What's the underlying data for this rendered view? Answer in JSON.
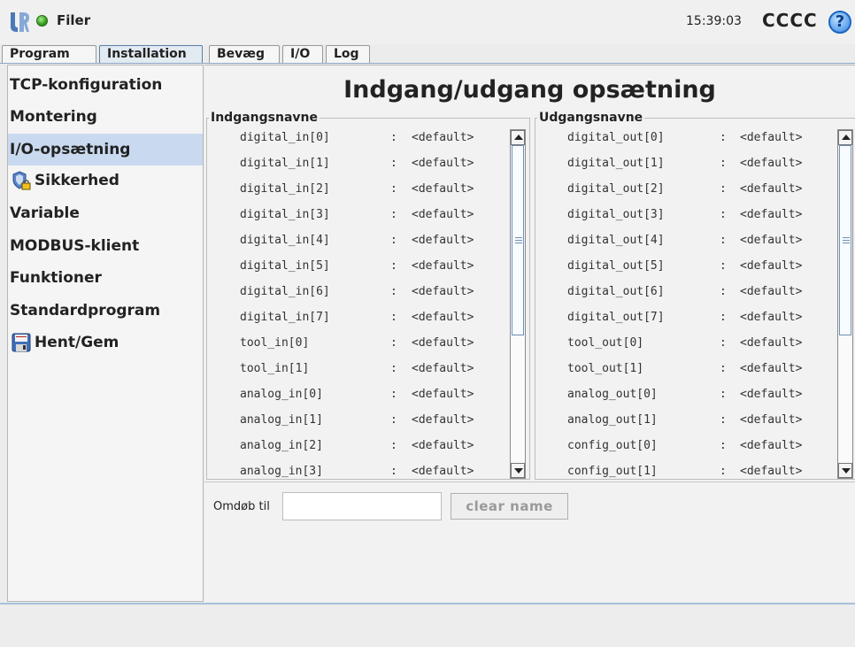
{
  "header": {
    "app_label": "Filer",
    "time": "15:39:03",
    "robot_name": "CCCC",
    "help_symbol": "?",
    "status_color": "#3aa020",
    "logo_icon": "ur-logo-icon"
  },
  "tabs": {
    "program": "Program",
    "installation": "Installation",
    "move": "Bevæg",
    "io": "I/O",
    "log": "Log"
  },
  "sidebar": {
    "items": [
      {
        "label": "TCP-konfiguration"
      },
      {
        "label": "Montering"
      },
      {
        "label": "I/O-opsætning"
      },
      {
        "label": "Sikkerhed",
        "icon": "shield-lock-icon"
      },
      {
        "label": "Variable"
      },
      {
        "label": "MODBUS-klient"
      },
      {
        "label": "Funktioner"
      },
      {
        "label": "Standardprogram"
      },
      {
        "label": "Hent/Gem",
        "icon": "floppy-disk-icon"
      }
    ],
    "active_index": 2
  },
  "main": {
    "title": "Indgang/udgang opsætning",
    "separator": ":",
    "inputs": {
      "title": "Indgangsnavne",
      "rows": [
        {
          "name": "digital_in[0]",
          "value": "<default>"
        },
        {
          "name": "digital_in[1]",
          "value": "<default>"
        },
        {
          "name": "digital_in[2]",
          "value": "<default>"
        },
        {
          "name": "digital_in[3]",
          "value": "<default>"
        },
        {
          "name": "digital_in[4]",
          "value": "<default>"
        },
        {
          "name": "digital_in[5]",
          "value": "<default>"
        },
        {
          "name": "digital_in[6]",
          "value": "<default>"
        },
        {
          "name": "digital_in[7]",
          "value": "<default>"
        },
        {
          "name": "tool_in[0]",
          "value": "<default>"
        },
        {
          "name": "tool_in[1]",
          "value": "<default>"
        },
        {
          "name": "analog_in[0]",
          "value": "<default>"
        },
        {
          "name": "analog_in[1]",
          "value": "<default>"
        },
        {
          "name": "analog_in[2]",
          "value": "<default>"
        },
        {
          "name": "analog_in[3]",
          "value": "<default>"
        }
      ]
    },
    "outputs": {
      "title": "Udgangsnavne",
      "rows": [
        {
          "name": "digital_out[0]",
          "value": "<default>"
        },
        {
          "name": "digital_out[1]",
          "value": "<default>"
        },
        {
          "name": "digital_out[2]",
          "value": "<default>"
        },
        {
          "name": "digital_out[3]",
          "value": "<default>"
        },
        {
          "name": "digital_out[4]",
          "value": "<default>"
        },
        {
          "name": "digital_out[5]",
          "value": "<default>"
        },
        {
          "name": "digital_out[6]",
          "value": "<default>"
        },
        {
          "name": "digital_out[7]",
          "value": "<default>"
        },
        {
          "name": "tool_out[0]",
          "value": "<default>"
        },
        {
          "name": "tool_out[1]",
          "value": "<default>"
        },
        {
          "name": "analog_out[0]",
          "value": "<default>"
        },
        {
          "name": "analog_out[1]",
          "value": "<default>"
        },
        {
          "name": "config_out[0]",
          "value": "<default>"
        },
        {
          "name": "config_out[1]",
          "value": "<default>"
        }
      ]
    },
    "rename": {
      "label": "Omdøb til",
      "value": "",
      "clear_label": "clear name"
    }
  }
}
